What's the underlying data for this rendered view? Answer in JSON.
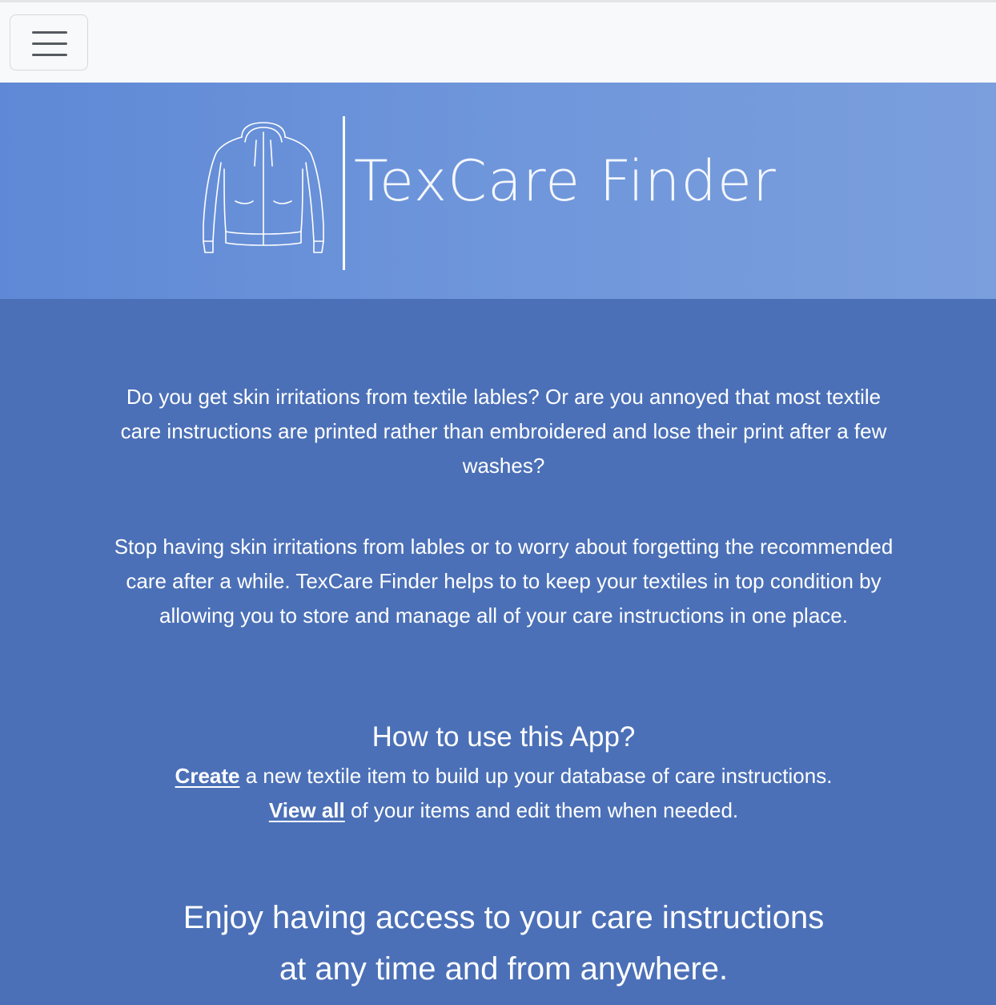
{
  "navbar": {
    "menu_icon": "hamburger-menu-icon"
  },
  "hero": {
    "logo_icon": "jacket-icon",
    "logo_text": "TexCare Finder"
  },
  "intro": {
    "paragraph_1": "Do you get skin irritations from textile lables? Or are you annoyed that most textile care instructions are printed rather than embroidered and lose their print after a few washes?",
    "paragraph_2": "Stop having skin irritations from lables or to worry about forgetting the recommended care after a while. TexCare Finder helps to to keep your textiles in top condition by allowing you to store and manage all of your care instructions in one place."
  },
  "howto": {
    "title": "How to use this App?",
    "create_link": "Create",
    "create_text": " a new textile item to build up your database of care instructions.",
    "view_link": "View all",
    "view_text": " of your items and edit them when needed."
  },
  "closing": {
    "line_1": "Enjoy having access to your care instructions",
    "line_2": "at any time and from anywhere."
  },
  "colors": {
    "navbar_bg": "#f8f9fa",
    "hero_bg": "#6f96db",
    "content_bg": "#4b70b7",
    "text": "#ffffff"
  }
}
